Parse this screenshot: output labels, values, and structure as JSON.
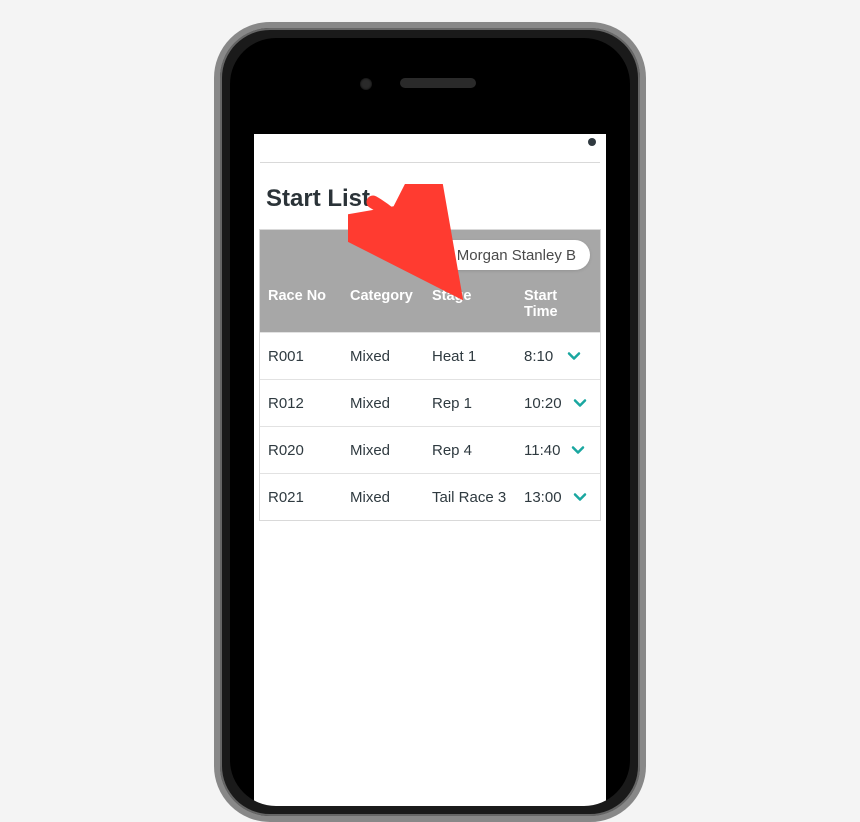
{
  "title": "Start List",
  "search": {
    "query": "Morgan Stanley B"
  },
  "columns": {
    "raceNo": "Race No",
    "category": "Category",
    "stage": "Stage",
    "startTime": "Start Time"
  },
  "rows": [
    {
      "raceNo": "R001",
      "category": "Mixed",
      "stage": "Heat 1",
      "startTime": "8:10"
    },
    {
      "raceNo": "R012",
      "category": "Mixed",
      "stage": "Rep 1",
      "startTime": "10:20"
    },
    {
      "raceNo": "R020",
      "category": "Mixed",
      "stage": "Rep 4",
      "startTime": "11:40"
    },
    {
      "raceNo": "R021",
      "category": "Mixed",
      "stage": "Tail Race 3",
      "startTime": "13:00"
    }
  ],
  "colors": {
    "accent": "#1aa7a0",
    "arrow": "#ff3b30"
  }
}
